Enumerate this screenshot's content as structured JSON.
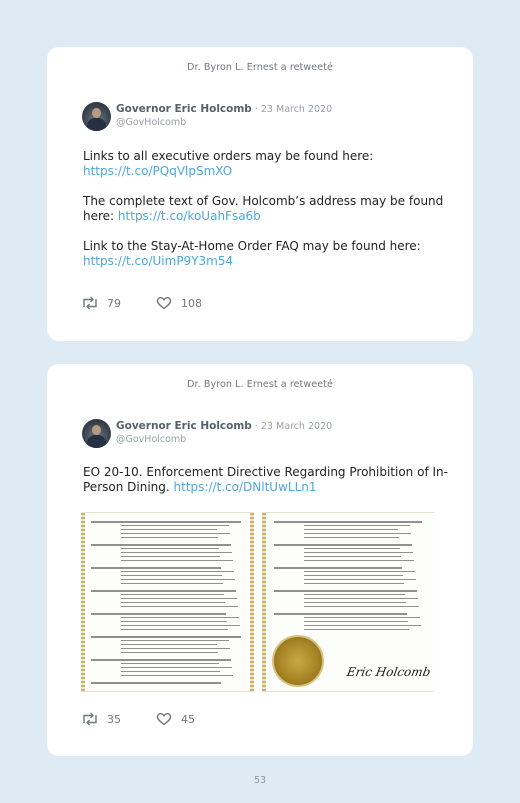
{
  "tweets": [
    {
      "retweet_header": "Dr. Byron L. Ernest a retweeté",
      "author_name": "Governor Eric Holcomb",
      "separator": " · ",
      "date": "23 March 2020",
      "handle": "@GovHolcomb",
      "paragraphs": [
        {
          "text": "Links to all executive orders may be found here:",
          "link": "https://t.co/PQqVlpSmXO"
        },
        {
          "text": "The complete text of Gov. Holcomb’s address may be found here:",
          "link": "https://t.co/koUahFsa6b"
        },
        {
          "text": "Link to the Stay-At-Home Order FAQ may be found here:",
          "link": "https://t.co/UimP9Y3m54"
        }
      ],
      "retweets": "79",
      "likes": "108"
    },
    {
      "retweet_header": "Dr. Byron L. Ernest a retweeté",
      "author_name": "Governor Eric Holcomb",
      "separator": " · ",
      "date": "23 March 2020",
      "handle": "@GovHolcomb",
      "text": "EO 20-10. Enforcement Directive Regarding Prohibition of In-Person Dining.",
      "link": "https://t.co/DNltUwLLn1",
      "signature": "Eric Holcomb",
      "retweets": "35",
      "likes": "45"
    }
  ],
  "page_number": "53",
  "colors": {
    "background": "#deebf5",
    "link": "#4aa8de",
    "card": "#ffffff"
  },
  "icons": [
    "retweet-icon",
    "heart-icon"
  ]
}
